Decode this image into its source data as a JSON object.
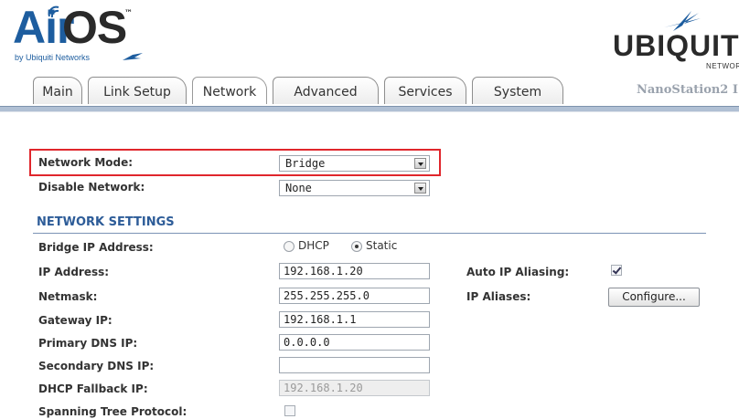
{
  "header": {
    "logo_air": "Air",
    "logo_os": "OS",
    "logo_tm": "™",
    "logo_by": "by Ubiquiti Networks",
    "brand": "UBIQUIT",
    "brand_sub": "NETWORK",
    "model": "NanoStation2 I"
  },
  "tabs": [
    "Main",
    "Link Setup",
    "Network",
    "Advanced",
    "Services",
    "System"
  ],
  "active_tab": "Network",
  "form": {
    "network_mode_label": "Network Mode:",
    "network_mode_value": "Bridge",
    "disable_network_label": "Disable Network:",
    "disable_network_value": "None",
    "section_title": "NETWORK SETTINGS",
    "bridge_ip_label": "Bridge IP Address:",
    "dhcp_label": "DHCP",
    "static_label": "Static",
    "bridge_ip_mode": "Static",
    "ip_label": "IP Address:",
    "ip_value": "192.168.1.20",
    "netmask_label": "Netmask:",
    "netmask_value": "255.255.255.0",
    "gateway_label": "Gateway IP:",
    "gateway_value": "192.168.1.1",
    "primary_dns_label": "Primary DNS IP:",
    "primary_dns_value": "0.0.0.0",
    "secondary_dns_label": "Secondary DNS IP:",
    "secondary_dns_value": "",
    "dhcp_fallback_label": "DHCP Fallback IP:",
    "dhcp_fallback_value": "192.168.1.20",
    "stp_label": "Spanning Tree Protocol:",
    "stp_checked": false,
    "auto_ip_alias_label": "Auto IP Aliasing:",
    "auto_ip_alias_checked": true,
    "ip_aliases_label": "IP Aliases:",
    "configure_button": "Configure..."
  },
  "colors": {
    "logo_blue": "#1d5d9f",
    "section_blue": "#2d5c98",
    "highlight_red": "#e0262c"
  }
}
